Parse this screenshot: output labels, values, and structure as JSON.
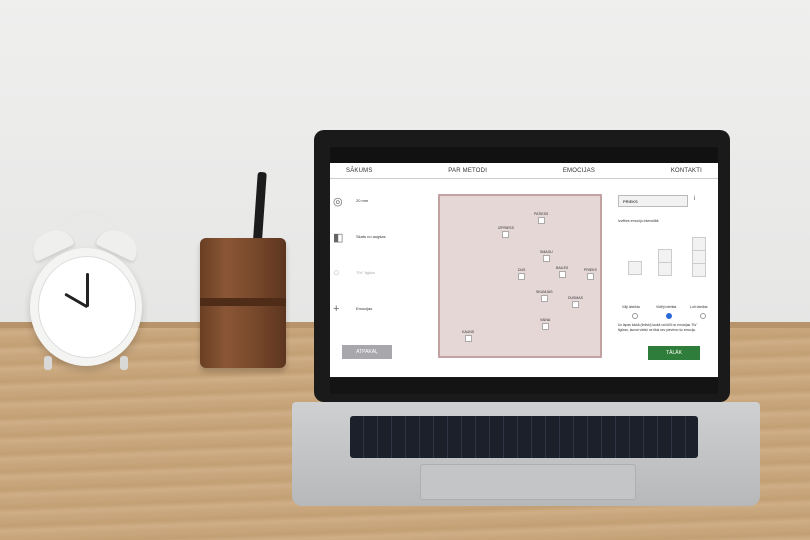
{
  "nav": {
    "items": [
      "SĀKUMS",
      "PAR METODI",
      "EMOCIJAS",
      "KONTAKTI"
    ]
  },
  "sidebar": {
    "steps": [
      "20 mm",
      "Skats no augšas",
      "\"Es\" figūra",
      "Emocijas"
    ],
    "back_label": "ATPAKAĻ"
  },
  "canvas": {
    "emotions": [
      "PATIESS",
      "IZPRIESS",
      "SMAGU",
      "BAILES",
      "PRIEKS",
      "DUS",
      "SKUMJAS",
      "DUSMAS",
      "VAINA",
      "KAUNS",
      "DUSMAS"
    ]
  },
  "panel": {
    "select_value": "PRIEKS",
    "instruction": "Izvēlies emociju intensitāti",
    "levels": [
      "Vāji izteikta",
      "Vidēji izteikta",
      "Ļoti izteikta"
    ],
    "selected_level": 1,
    "note": "Uz lapas tukšā (lieliski) laukā vai tūlīt no emocijas \"Es\" figūras, ļaunai vietiņi ne tikai sev pievieno šo emociju.",
    "next_label": "TĀLĀK"
  },
  "colors": {
    "canvas_bg": "#e5d7d6",
    "canvas_border": "#c3a3a2",
    "next_button": "#2f7d3a",
    "back_button": "#a8a8ac"
  }
}
